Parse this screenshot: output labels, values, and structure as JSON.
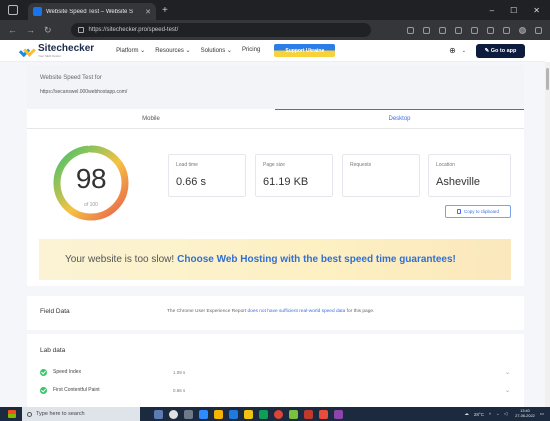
{
  "browser": {
    "tab_title": "Website Speed Test – Website S",
    "url": "https://sitechecker.pro/speed-test/",
    "window_controls": [
      "–",
      "☐",
      "✕"
    ]
  },
  "header": {
    "logo_name": "Sitechecker",
    "logo_tagline": "Your SEO Doctor",
    "nav": [
      "Platform ⌄",
      "Resources ⌄",
      "Solutions ⌄",
      "Pricing"
    ],
    "support_label": "Support Ukraine",
    "goto_label": "Go to app",
    "globe_chev": "⌄"
  },
  "test": {
    "title": "Website Speed Test for",
    "url": "https://secanswel.000webhostapp.com/"
  },
  "tabs": {
    "mobile": "Mobile",
    "desktop": "Desktop",
    "active": "desktop"
  },
  "score": {
    "value": "98",
    "of_label": "of 100",
    "fraction": 0.98
  },
  "metrics": [
    {
      "label": "Load time",
      "value": "0.66 s"
    },
    {
      "label": "Page size",
      "value": "61.19 KB"
    },
    {
      "label": "Requests",
      "value": ""
    },
    {
      "label": "Location",
      "value": "Asheville"
    }
  ],
  "copy_label": "Copy to clipboard",
  "banner": {
    "text": "Your website is too slow!",
    "link": "Choose Web Hosting with the best speed time guarantees!"
  },
  "field_data": {
    "title": "Field Data",
    "text_before": "The Chrome User Experience Report",
    "link": "does not have sufficient real-world speed data",
    "text_after": "for this page."
  },
  "lab_data": {
    "title": "Lab data",
    "rows": [
      {
        "name": "Speed Index",
        "value": "1.09 s"
      },
      {
        "name": "First Contentful Paint",
        "value": "0.66 s"
      }
    ]
  },
  "taskbar": {
    "search_placeholder": "Type here to search",
    "weather": "28°C",
    "time": "13:40",
    "date": "27-06-2022"
  },
  "colors": {
    "accent": "#3d6fe0",
    "gauge_start": "#e95b4b",
    "gauge_mid": "#f6c244",
    "gauge_end": "#3cc26b",
    "banner_link": "#2f6fd6"
  }
}
